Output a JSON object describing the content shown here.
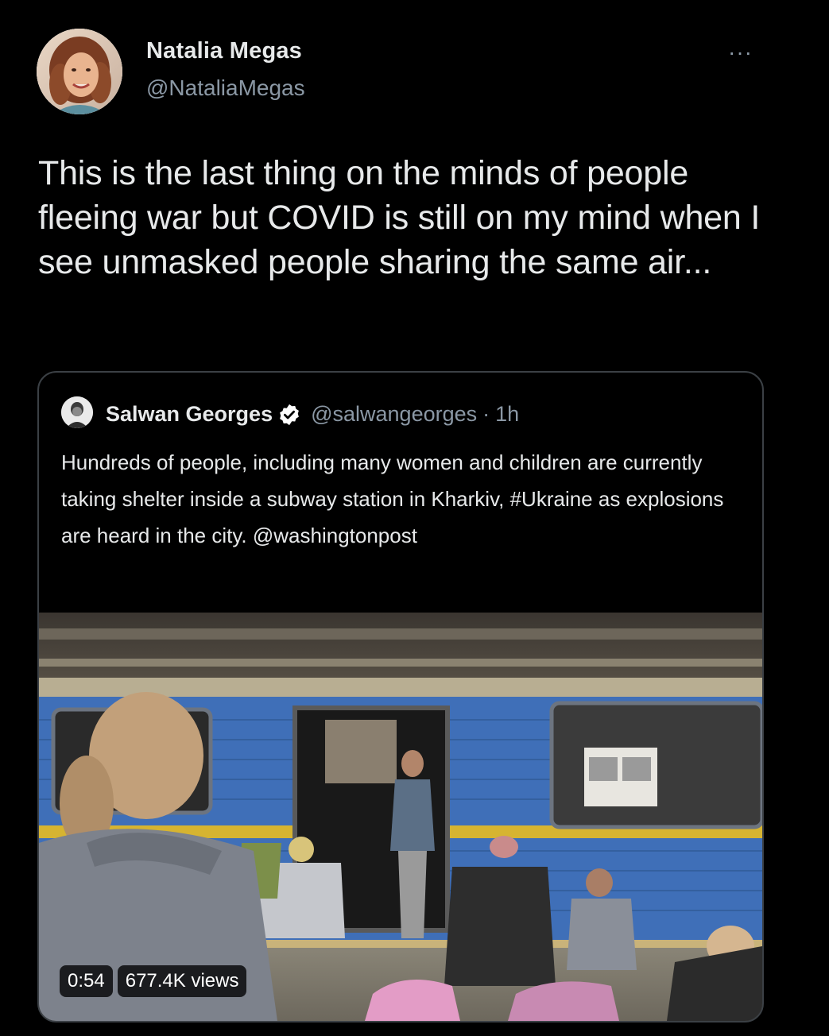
{
  "tweet": {
    "author": {
      "name": "Natalia Megas",
      "handle": "@NataliaMegas"
    },
    "more_label": "···",
    "text": "This is the last thing on the minds of people fleeing war but COVID is still on my mind when I see unmasked people sharing the same air..."
  },
  "quoted": {
    "author": {
      "name": "Salwan Georges",
      "handle": "@salwangeorges",
      "separator": "·",
      "time": "1h",
      "verified": true
    },
    "text": "Hundreds of people, including many women and children are currently taking shelter inside a subway station in Kharkiv, #Ukraine as explosions are heard in the city. @washingtonpost",
    "media": {
      "type": "video",
      "duration": "0:54",
      "views": "677.4K views"
    }
  },
  "colors": {
    "background": "#000000",
    "text": "#e7e9ea",
    "secondary_text": "#8b98a5",
    "verified_badge": "#ffffff",
    "train_blue": "#3f6fb8",
    "train_stripe": "#d6b431"
  },
  "icons": [
    "more-icon",
    "verified-icon"
  ]
}
